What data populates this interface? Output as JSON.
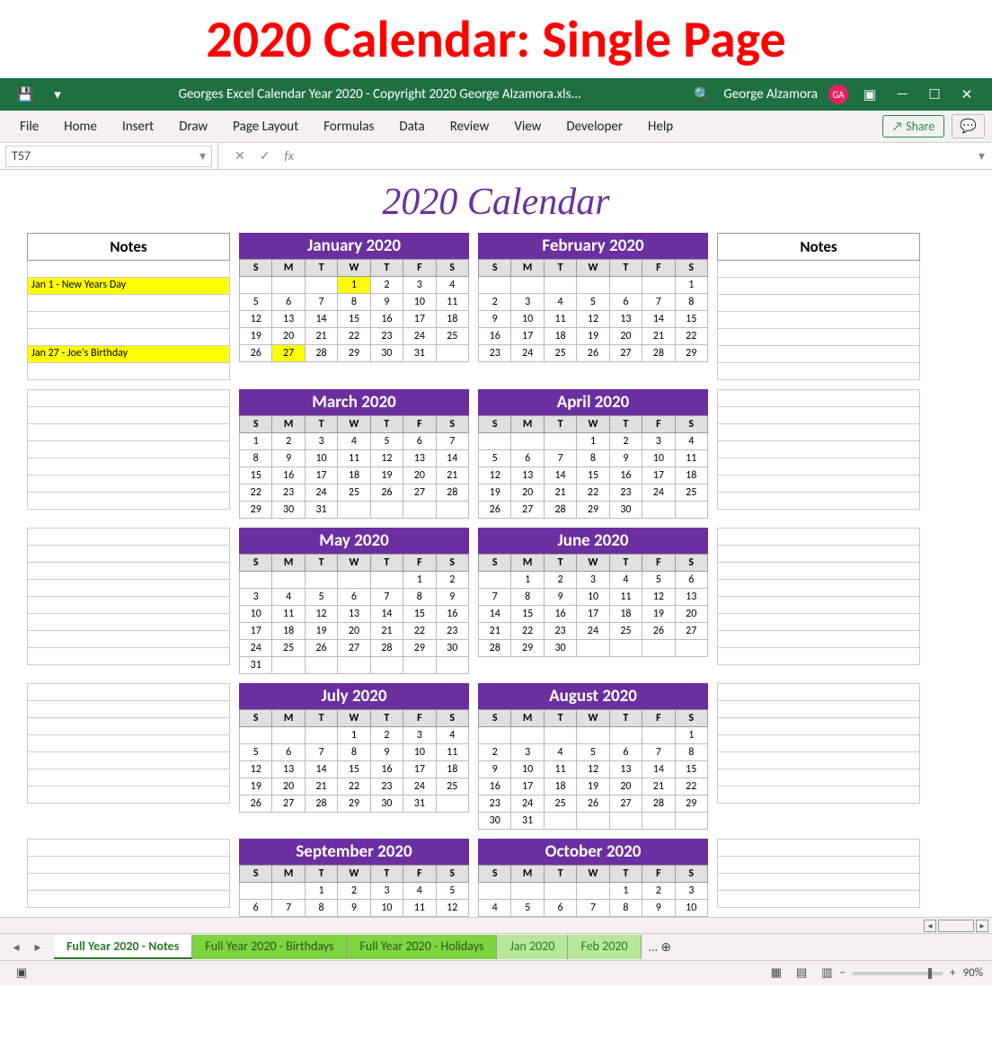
{
  "page_heading": "2020 Calendar: Single Page",
  "titlebar": {
    "filename": "Georges Excel Calendar Year 2020 - Copyright 2020  George Alzamora.xls...",
    "user": "George Alzamora",
    "initials": "GA"
  },
  "ribbon": [
    "File",
    "Home",
    "Insert",
    "Draw",
    "Page Layout",
    "Formulas",
    "Data",
    "Review",
    "View",
    "Developer",
    "Help"
  ],
  "share": "Share",
  "name_box": "T57",
  "cal_title": "2020 Calendar",
  "notes_hdr": "Notes",
  "notes_left": [
    "",
    "Jan 1  - New Years Day",
    "",
    "",
    "",
    "Jan 27 - Joe's Birthday",
    ""
  ],
  "hl_left": [
    1,
    5
  ],
  "notes_side_rows": 7,
  "days": [
    "S",
    "M",
    "T",
    "W",
    "T",
    "F",
    "S"
  ],
  "months": [
    {
      "name": "January 2020",
      "start": 3,
      "len": 31,
      "hl": [
        1,
        27
      ]
    },
    {
      "name": "February 2020",
      "start": 6,
      "len": 29,
      "hl": []
    },
    {
      "name": "March 2020",
      "start": 0,
      "len": 31,
      "hl": []
    },
    {
      "name": "April 2020",
      "start": 3,
      "len": 30,
      "hl": []
    },
    {
      "name": "May 2020",
      "start": 5,
      "len": 31,
      "hl": []
    },
    {
      "name": "June 2020",
      "start": 1,
      "len": 30,
      "hl": []
    },
    {
      "name": "July 2020",
      "start": 3,
      "len": 31,
      "hl": []
    },
    {
      "name": "August 2020",
      "start": 6,
      "len": 31,
      "hl": []
    },
    {
      "name": "September 2020",
      "start": 2,
      "len": 30,
      "hl": [],
      "maxrows": 2
    },
    {
      "name": "October 2020",
      "start": 4,
      "len": 31,
      "hl": [],
      "maxrows": 2
    }
  ],
  "sheet_tabs": [
    "Full Year 2020 - Notes",
    "Full Year 2020 - Birthdays",
    "Full Year 2020 - Holidays",
    "Jan 2020",
    "Feb 2020"
  ],
  "zoom": "90%"
}
